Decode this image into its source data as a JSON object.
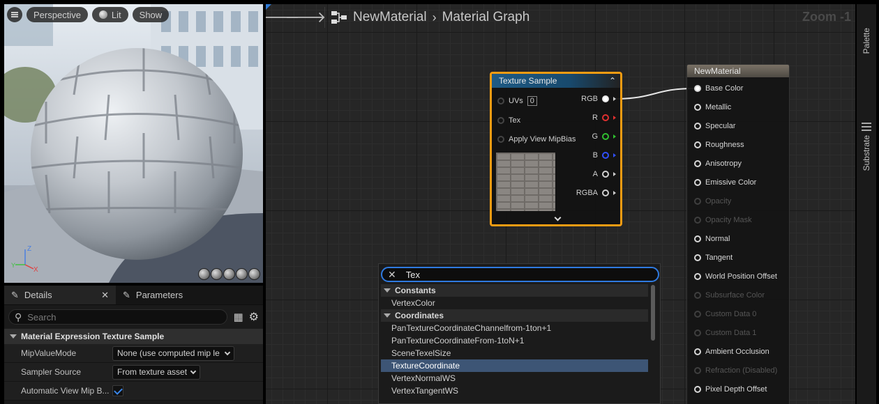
{
  "viewport": {
    "buttons": {
      "perspective": "Perspective",
      "lit": "Lit",
      "show": "Show"
    },
    "axes": {
      "z": "Z",
      "x": "X",
      "y": "Y"
    }
  },
  "details": {
    "tabs": {
      "details": "Details",
      "parameters": "Parameters"
    },
    "search_placeholder": "Search",
    "section": "Material Expression Texture Sample",
    "props": [
      {
        "name": "MipValueMode",
        "value": "None (use computed mip le"
      },
      {
        "name": "Sampler Source",
        "value": "From texture asset"
      },
      {
        "name": "Automatic View Mip B...",
        "value": ""
      }
    ]
  },
  "graph": {
    "breadcrumb": {
      "asset": "NewMaterial",
      "graph": "Material Graph"
    },
    "zoom": "Zoom -1",
    "texture_node": {
      "title": "Texture Sample",
      "inputs": [
        "UVs",
        "Tex",
        "Apply View MipBias"
      ],
      "uv_value": "0",
      "outputs": [
        "RGB",
        "R",
        "G",
        "B",
        "A",
        "RGBA"
      ],
      "output_colors": [
        "#e8e8e8",
        "#e03030",
        "#30c030",
        "#3050ff",
        "#d0d0d0",
        "#d0d0d0"
      ]
    },
    "material_node": {
      "title": "NewMaterial",
      "pins": [
        {
          "label": "Base Color",
          "state": "connected"
        },
        {
          "label": "Metallic",
          "state": "on"
        },
        {
          "label": "Specular",
          "state": "on"
        },
        {
          "label": "Roughness",
          "state": "on"
        },
        {
          "label": "Anisotropy",
          "state": "on"
        },
        {
          "label": "Emissive Color",
          "state": "on"
        },
        {
          "label": "Opacity",
          "state": "disabled"
        },
        {
          "label": "Opacity Mask",
          "state": "disabled"
        },
        {
          "label": "Normal",
          "state": "on"
        },
        {
          "label": "Tangent",
          "state": "on"
        },
        {
          "label": "World Position Offset",
          "state": "on"
        },
        {
          "label": "Subsurface Color",
          "state": "disabled"
        },
        {
          "label": "Custom Data 0",
          "state": "disabled"
        },
        {
          "label": "Custom Data 1",
          "state": "disabled"
        },
        {
          "label": "Ambient Occlusion",
          "state": "on"
        },
        {
          "label": "Refraction (Disabled)",
          "state": "disabled"
        },
        {
          "label": "Pixel Depth Offset",
          "state": "on"
        }
      ]
    },
    "search_popup": {
      "query": "Tex",
      "categories": [
        {
          "name": "Constants",
          "items": [
            "VertexColor"
          ]
        },
        {
          "name": "Coordinates",
          "items": [
            "PanTextureCoordinateChannelfrom-1ton+1",
            "PanTextureCoordinateFrom-1toN+1",
            "SceneTexelSize",
            "TextureCoordinate",
            "VertexNormalWS",
            "VertexTangentWS"
          ]
        }
      ],
      "selected": "TextureCoordinate"
    }
  },
  "dock": {
    "palette": "Palette",
    "substrate": "Substrate"
  }
}
